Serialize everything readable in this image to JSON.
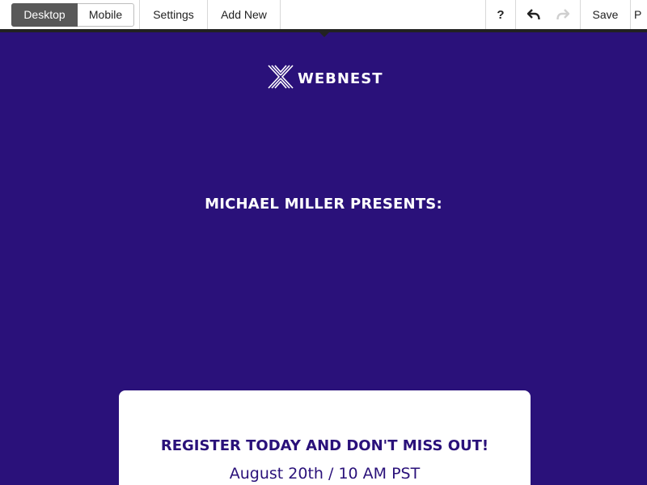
{
  "toolbar": {
    "view_toggle": {
      "desktop_label": "Desktop",
      "mobile_label": "Mobile",
      "active": "Desktop"
    },
    "settings_label": "Settings",
    "add_new_label": "Add New",
    "help_label": "?",
    "undo_icon": "undo-arrow-icon",
    "redo_icon": "redo-arrow-icon",
    "redo_enabled": false,
    "save_label": "Save",
    "preview_label_partial": "P"
  },
  "page": {
    "background_color": "#2a117a",
    "logo_text": "WEBNEST",
    "logo_icon": "webnest-x-logo-icon",
    "presenter_heading": "MICHAEL MILLER PRESENTS:",
    "card": {
      "title": "REGISTER TODAY AND DON'T MISS OUT!",
      "date": "August 20th / 10 AM PST",
      "text_color": "#2a117a"
    }
  }
}
